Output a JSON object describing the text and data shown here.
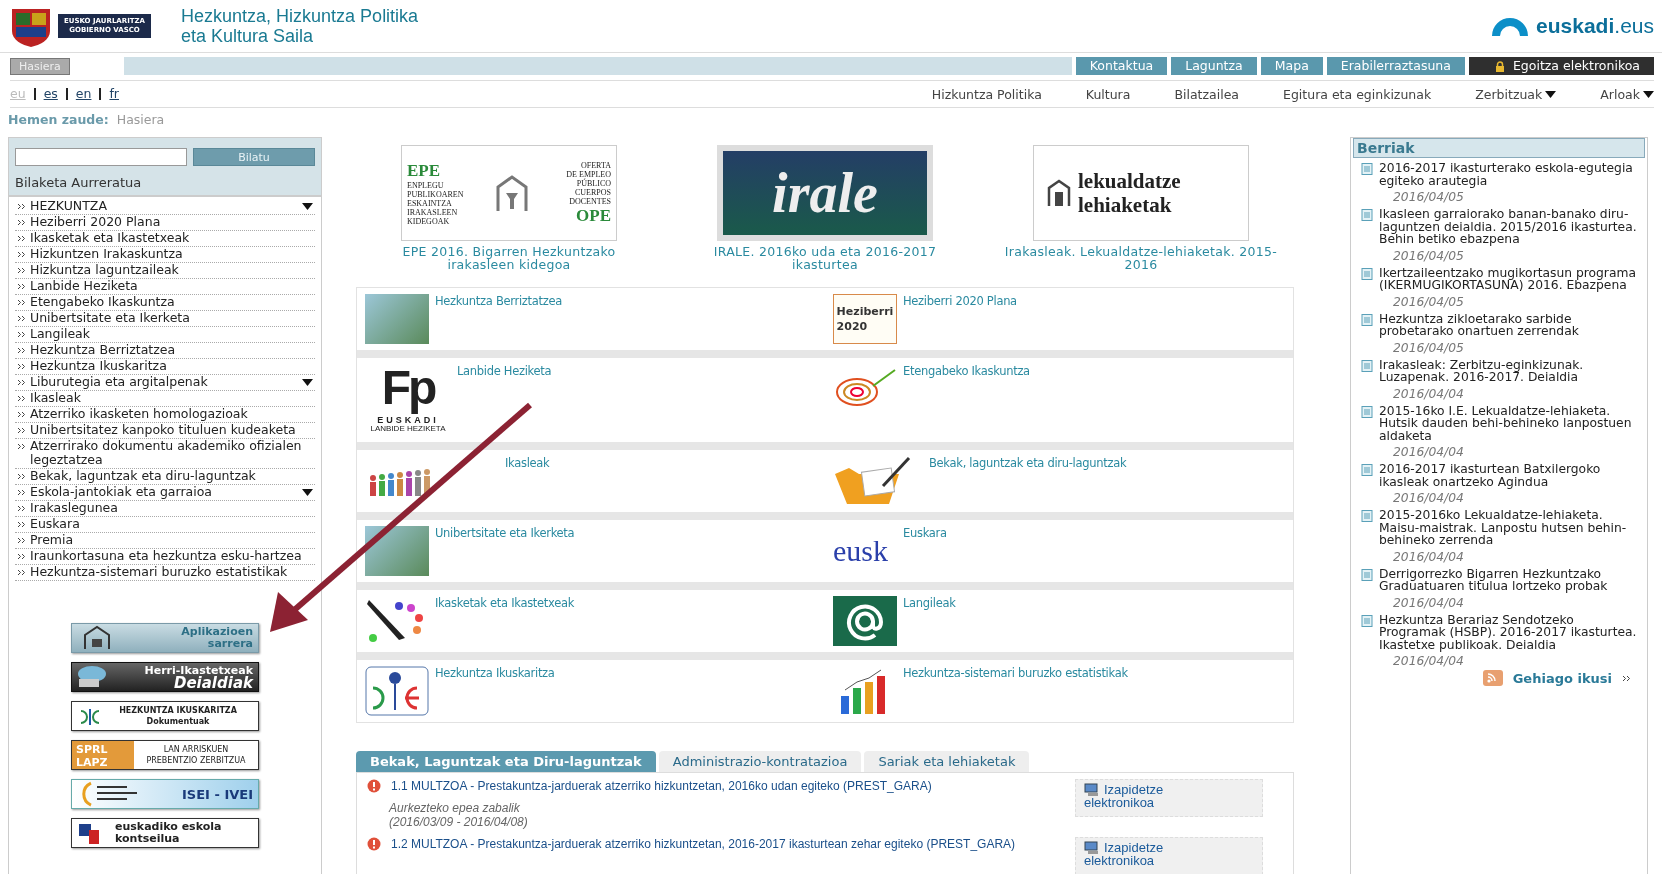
{
  "header": {
    "logo_text": [
      "EUSKO JAURLARITZA",
      "GOBIERNO VASCO"
    ],
    "title": [
      "Hezkuntza, Hizkuntza Politika",
      "eta Kultura Saila"
    ],
    "portal": "**euskadi**.eus"
  },
  "top_nav": {
    "home": "Hasiera",
    "links": [
      "Kontaktua",
      "Laguntza",
      "Mapa",
      "Erabilerraztasuna"
    ],
    "eoffice": "Egoitza elektronikoa"
  },
  "languages": [
    {
      "label": "eu",
      "selected": true
    },
    {
      "label": "es",
      "selected": false
    },
    {
      "label": "en",
      "selected": false
    },
    {
      "label": "fr",
      "selected": false
    }
  ],
  "menu": [
    {
      "label": "Hizkuntza Politika",
      "dropdown": false
    },
    {
      "label": "Kultura",
      "dropdown": false
    },
    {
      "label": "Bilatzailea",
      "dropdown": false
    },
    {
      "label": "Egitura eta eginkizunak",
      "dropdown": false
    },
    {
      "label": "Zerbitzuak",
      "dropdown": true
    },
    {
      "label": "Arloak",
      "dropdown": true
    }
  ],
  "breadcrumb": {
    "label": "Hemen zaude:",
    "items": [
      "Hasiera"
    ]
  },
  "search": {
    "button": "Bilatu",
    "advanced": "Bilaketa Aurreratua"
  },
  "sidebar_menu": [
    {
      "label": "HEZKUNTZA",
      "expandable": true
    },
    {
      "label": "Heziberri 2020 Plana",
      "expandable": false
    },
    {
      "label": "Ikasketak eta Ikastetxeak",
      "expandable": false
    },
    {
      "label": "Hizkuntzen Irakaskuntza",
      "expandable": false
    },
    {
      "label": "Hizkuntza laguntzaileak",
      "expandable": false
    },
    {
      "label": "Lanbide Heziketa",
      "expandable": false
    },
    {
      "label": "Etengabeko Ikaskuntza",
      "expandable": false
    },
    {
      "label": "Unibertsitate eta Ikerketa",
      "expandable": false
    },
    {
      "label": "Langileak",
      "expandable": false
    },
    {
      "label": "Hezkuntza Berriztatzea",
      "expandable": false
    },
    {
      "label": "Hezkuntza Ikuskaritza",
      "expandable": false
    },
    {
      "label": "Liburutegia eta argitalpenak",
      "expandable": true
    },
    {
      "label": "Ikasleak",
      "expandable": false
    },
    {
      "label": "Atzerriko ikasketen homologazioak",
      "expandable": false
    },
    {
      "label": "Unibertsitatez kanpoko tituluen kudeaketa",
      "expandable": false
    },
    {
      "label": "Atzerrirako dokumentu akademiko ofizialen legeztatzea",
      "expandable": false
    },
    {
      "label": "Bekak, laguntzak eta diru-laguntzak",
      "expandable": false
    },
    {
      "label": "Eskola-jantokiak eta garraioa",
      "expandable": true
    },
    {
      "label": "Irakaslegunea",
      "expandable": false
    },
    {
      "label": "Euskara",
      "expandable": false
    },
    {
      "label": "Premia",
      "expandable": false
    },
    {
      "label": "Iraunkortasuna eta hezkuntza esku-hartzea",
      "expandable": false
    },
    {
      "label": "Hezkuntza-sistemari buruzko estatistikak",
      "expandable": false
    }
  ],
  "banners": [
    {
      "kind": "apps",
      "lines": [
        "Aplikazioen",
        "sarrera"
      ]
    },
    {
      "kind": "schools",
      "lines": [
        "Herri-Ikastetxeak",
        "Deialdiak"
      ]
    },
    {
      "kind": "inspection",
      "lines": [
        "HEZKUNTZA IKUSKARITZA",
        "Dokumentuak"
      ]
    },
    {
      "kind": "sprl",
      "logo_lines": [
        "SPRL",
        "LAPZ"
      ],
      "lines": [
        "LAN ARRISKUEN",
        "PREBENTZIO ZERBITZUA"
      ]
    },
    {
      "kind": "isei",
      "lines": [
        "ISEI - IVEI"
      ]
    },
    {
      "kind": "council",
      "lines": [
        "euskadiko eskola",
        "kontseilua"
      ]
    }
  ],
  "featured": [
    {
      "kind": "epe",
      "image_text": [
        "EPE",
        "ENPLEGU",
        "PUBLIKOAREN",
        "ESKAINTZA",
        "IRAKASLEEN",
        "KIDEGOAK",
        "OFERTA",
        "DE EMPLEO",
        "PÚBLICO",
        "CUERPOS",
        "DOCENTES",
        "OPE"
      ],
      "caption": "EPE 2016. Bigarren Hezkuntzako irakasleen kidegoa"
    },
    {
      "kind": "irale",
      "image_text": [
        "irale"
      ],
      "caption": "IRALE. 2016ko uda eta 2016-2017 ikasturtea"
    },
    {
      "kind": "transfer",
      "image_text": [
        "lekualdatze",
        "lehiaketak"
      ],
      "caption": "Irakasleak. Lekualdatze-lehiaketak. 2015-2016"
    }
  ],
  "topics": [
    {
      "kind": "photo",
      "label": "Hezkuntza Berriztatzea"
    },
    {
      "kind": "heziberri",
      "image_text": [
        "Heziberri",
        "2020"
      ],
      "label": "Heziberri 2020 Plana"
    },
    {
      "kind": "fp",
      "image_text": [
        "Fp",
        "EUSKADI",
        "LANBIDE HEZIKETA"
      ],
      "label": "Lanbide Heziketa"
    },
    {
      "kind": "scribble",
      "label": "Etengabeko Ikaskuntza"
    },
    {
      "kind": "people",
      "label": "Ikasleak"
    },
    {
      "kind": "folder",
      "label": "Bekak, laguntzak eta diru-laguntzak"
    },
    {
      "kind": "photo",
      "label": "Unibertsitate eta Ikerketa"
    },
    {
      "kind": "eusk",
      "image_text": [
        "eusk"
      ],
      "label": "Euskara"
    },
    {
      "kind": "pencil",
      "label": "Ikasketak eta Ikastetxeak"
    },
    {
      "kind": "at",
      "label": "Langileak"
    },
    {
      "kind": "inspection",
      "label": "Hezkuntza Ikuskaritza"
    },
    {
      "kind": "bars",
      "label": "Hezkuntza-sistemari buruzko estatistikak"
    }
  ],
  "tabs": [
    {
      "label": "Bekak, Laguntzak eta Diru-laguntzak",
      "selected": true
    },
    {
      "label": "Administrazio-kontratazioa",
      "selected": false
    },
    {
      "label": "Sariak eta lehiaketak",
      "selected": false
    }
  ],
  "calls": [
    {
      "title": "1.1 MULTZOA - Prestakuntza-jarduerak atzerriko hizkuntzetan, 2016ko udan egiteko (PREST_GARA)",
      "status": "Aurkezteko epea zabalik",
      "period": "(2016/03/09 - 2016/04/08)",
      "action": "Izapidetze elektronikoa"
    },
    {
      "title": "1.2 MULTZOA - Prestakuntza-jarduerak atzerriko hizkuntzetan, 2016-2017 ikasturtean zehar egiteko (PREST_GARA)",
      "action": "Izapidetze elektronikoa"
    }
  ],
  "news": {
    "title": "Berriak",
    "items": [
      {
        "title": "2016-2017 ikasturterako eskola-egutegia egiteko arautegia",
        "date": "2016/04/05"
      },
      {
        "title": "Ikasleen garraiorako banan-banako diru-laguntzen deialdia. 2015/2016 ikasturtea. Behin betiko ebazpena",
        "date": "2016/04/05"
      },
      {
        "title": "Ikertzaileentzako mugikortasun programa (IKERMUGIKORTASUNA) 2016. Ebazpena",
        "date": "2016/04/05"
      },
      {
        "title": "Hezkuntza zikloetarako sarbide probetarako onartuen zerrendak",
        "date": "2016/04/05"
      },
      {
        "title": "Irakasleak: Zerbitzu-eginkizunak. Luzapenak. 2016-2017. Deialdia",
        "date": "2016/04/04"
      },
      {
        "title": "2015-16ko I.E. Lekualdatze-lehiaketa. Hutsik dauden behi-behineko lanpostuen aldaketa",
        "date": "2016/04/04"
      },
      {
        "title": "2016-2017 ikasturtean Batxilergoko ikasleak onartzeko Agindua",
        "date": "2016/04/04"
      },
      {
        "title": "2015-2016ko Lekualdatze-lehiaketa. Maisu-maistrak. Lanpostu hutsen behin-behineko zerrenda",
        "date": "2016/04/04"
      },
      {
        "title": "Derrigorrezko Bigarren Hezkuntzako Graduatuaren titulua lortzeko probak",
        "date": "2016/04/04"
      },
      {
        "title": "Hezkuntza Berariaz Sendotzeko Programak (HSBP). 2016-2017 ikasturtea. Ikastetxe publikoak. Deialdia",
        "date": "2016/04/04"
      }
    ],
    "more": "Gehiago ikusi"
  }
}
